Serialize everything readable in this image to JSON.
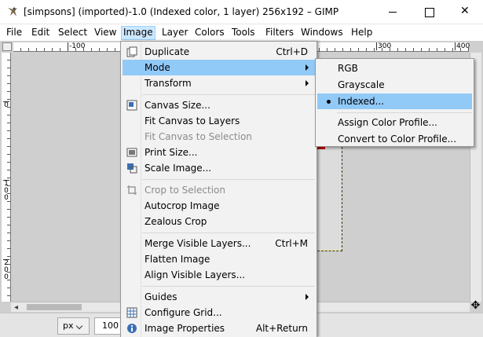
{
  "window": {
    "title": "[simpsons] (imported)-1.0 (Indexed color, 1 layer) 256x192 – GIMP",
    "close_glyph": "✕"
  },
  "menubar": [
    {
      "name": "menu-file",
      "label": "File"
    },
    {
      "name": "menu-edit",
      "label": "Edit"
    },
    {
      "name": "menu-select",
      "label": "Select"
    },
    {
      "name": "menu-view",
      "label": "View"
    },
    {
      "name": "menu-image",
      "label": "Image",
      "active": true
    },
    {
      "name": "menu-layer",
      "label": "Layer"
    },
    {
      "name": "menu-colors",
      "label": "Colors"
    },
    {
      "name": "menu-tools",
      "label": "Tools"
    },
    {
      "name": "menu-filters",
      "label": "Filters"
    },
    {
      "name": "menu-windows",
      "label": "Windows"
    },
    {
      "name": "menu-help",
      "label": "Help"
    }
  ],
  "ruler": {
    "h_labels": [
      "-100",
      "300",
      "400"
    ],
    "v_labels": [
      "0",
      "1 0 0",
      "2 0 0"
    ]
  },
  "image_menu": [
    {
      "name": "menu-item-duplicate",
      "label": "Duplicate",
      "accel": "Ctrl+D",
      "icon": "duplicate-icon"
    },
    {
      "name": "menu-item-mode",
      "label": "Mode",
      "submenu": true,
      "highlighted": true
    },
    {
      "name": "menu-item-transform",
      "label": "Transform",
      "submenu": true
    },
    {
      "sep": true
    },
    {
      "name": "menu-item-canvas-size",
      "label": "Canvas Size...",
      "icon": "canvas-size-icon"
    },
    {
      "name": "menu-item-fit-canvas-to-layers",
      "label": "Fit Canvas to Layers"
    },
    {
      "name": "menu-item-fit-canvas-to-selection",
      "label": "Fit Canvas to Selection",
      "disabled": true
    },
    {
      "name": "menu-item-print-size",
      "label": "Print Size...",
      "icon": "print-size-icon"
    },
    {
      "name": "menu-item-scale-image",
      "label": "Scale Image...",
      "icon": "scale-image-icon"
    },
    {
      "sep": true
    },
    {
      "name": "menu-item-crop-to-selection",
      "label": "Crop to Selection",
      "disabled": true,
      "icon": "crop-icon"
    },
    {
      "name": "menu-item-autocrop-image",
      "label": "Autocrop Image"
    },
    {
      "name": "menu-item-zealous-crop",
      "label": "Zealous Crop"
    },
    {
      "sep": true
    },
    {
      "name": "menu-item-merge-visible-layers",
      "label": "Merge Visible Layers...",
      "accel": "Ctrl+M"
    },
    {
      "name": "menu-item-flatten-image",
      "label": "Flatten Image"
    },
    {
      "name": "menu-item-align-visible-layers",
      "label": "Align Visible Layers..."
    },
    {
      "sep": true
    },
    {
      "name": "menu-item-guides",
      "label": "Guides",
      "submenu": true
    },
    {
      "name": "menu-item-configure-grid",
      "label": "Configure Grid...",
      "icon": "grid-icon"
    },
    {
      "name": "menu-item-image-properties",
      "label": "Image Properties",
      "accel": "Alt+Return",
      "icon": "info-icon"
    }
  ],
  "mode_menu": [
    {
      "name": "mode-item-rgb",
      "label": "RGB"
    },
    {
      "name": "mode-item-grayscale",
      "label": "Grayscale"
    },
    {
      "name": "mode-item-indexed",
      "label": "Indexed...",
      "checked": true,
      "highlighted": true
    },
    {
      "sep": true
    },
    {
      "name": "mode-item-assign-color-profile",
      "label": "Assign Color Profile..."
    },
    {
      "name": "mode-item-convert-to-color-profile",
      "label": "Convert to Color Profile..."
    }
  ],
  "statusbar": {
    "unit": "px",
    "zoom": "100 %"
  },
  "colors": {
    "highlight": "#91c9f7",
    "menubar_active": "#cce8ff"
  }
}
